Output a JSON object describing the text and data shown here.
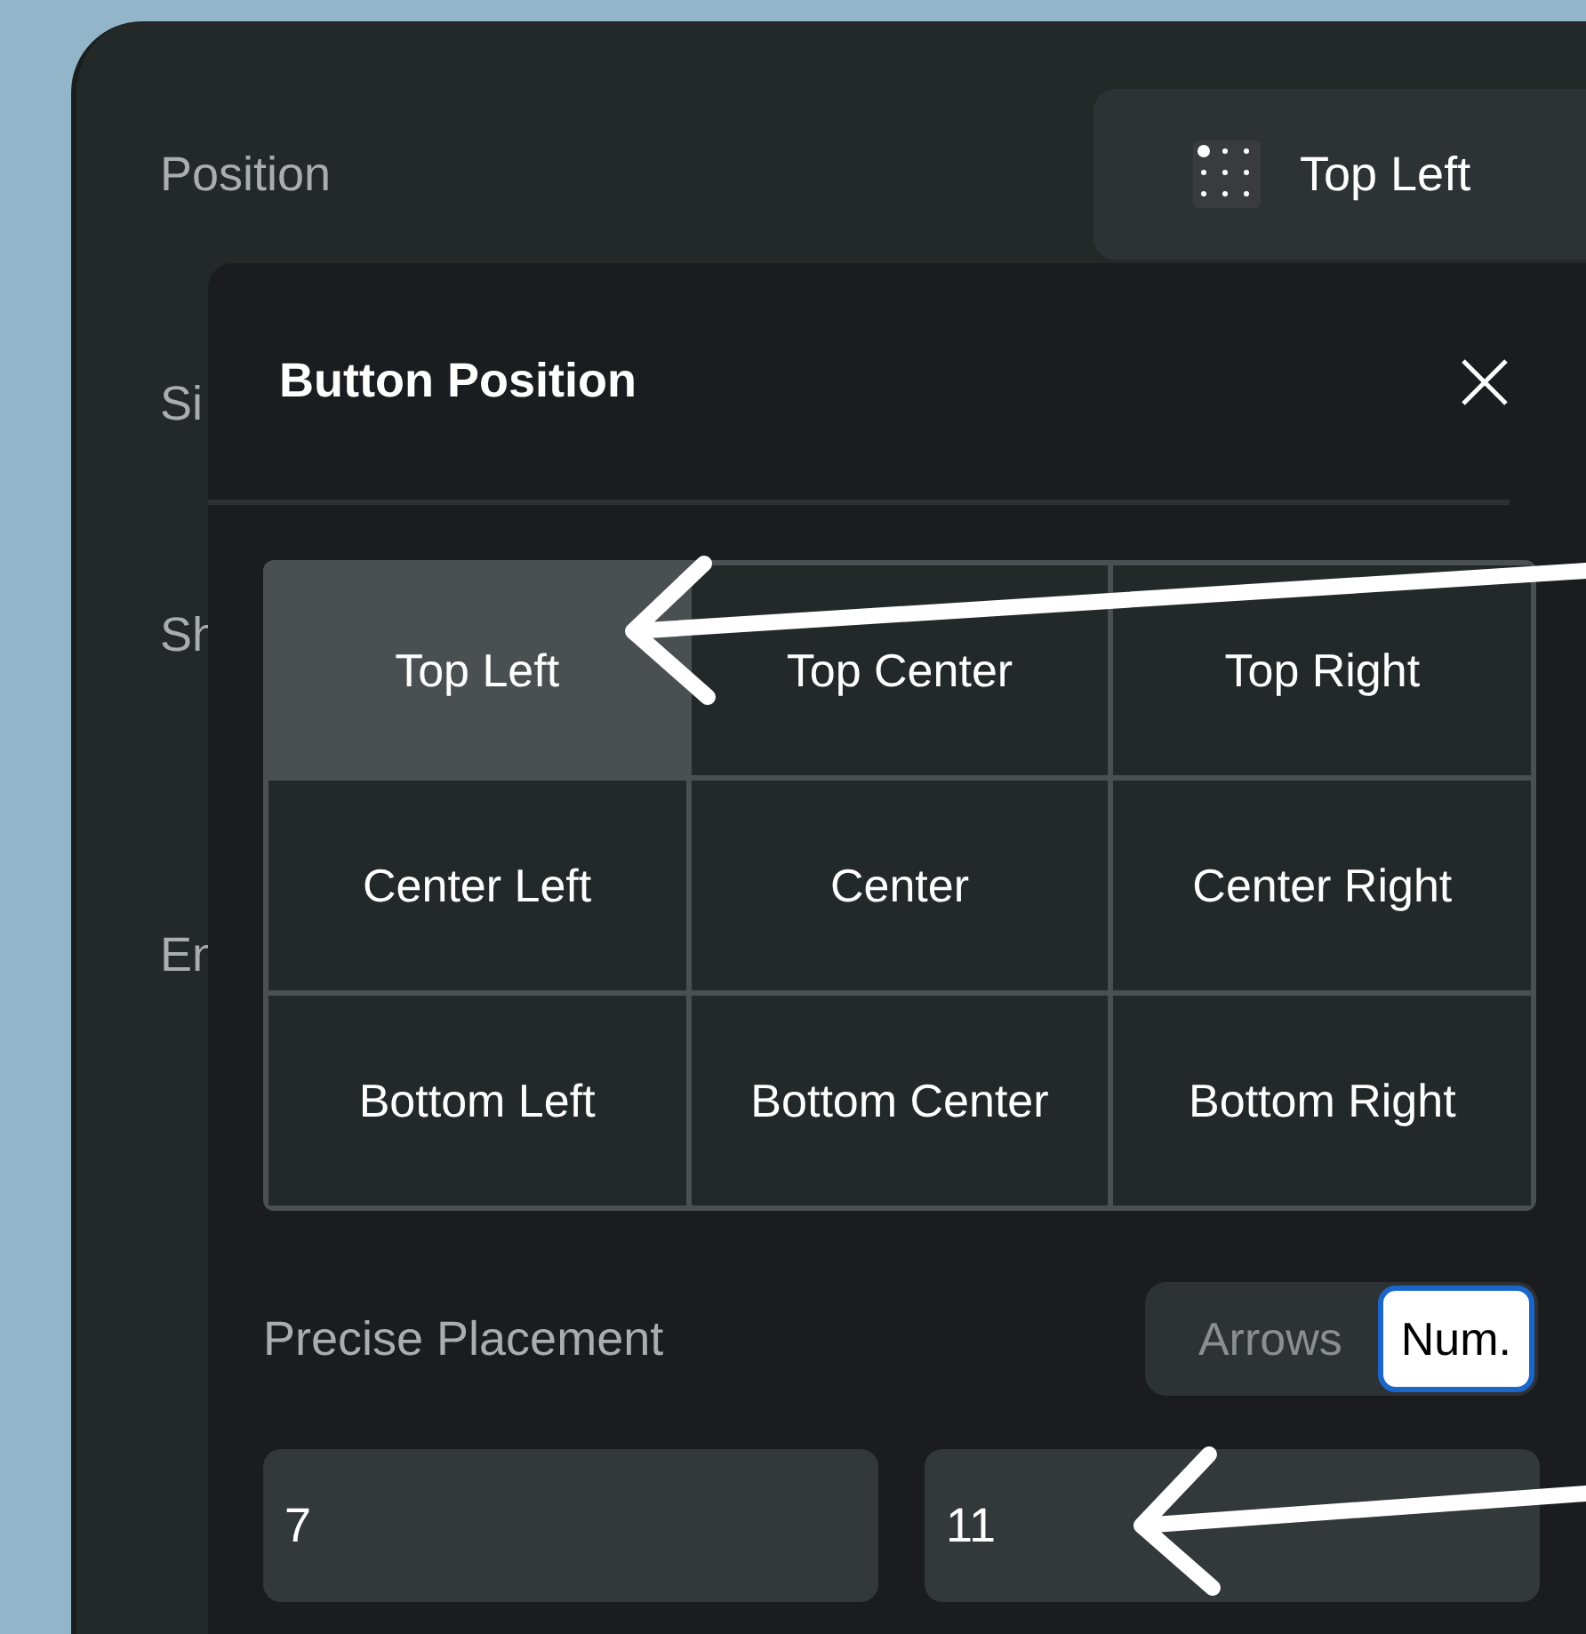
{
  "panel": {
    "labels": [
      {
        "text": "Position"
      },
      {
        "text": "Si"
      },
      {
        "text": "Sh"
      },
      {
        "text": "En"
      }
    ],
    "position_value": "Top Left"
  },
  "dialog": {
    "title": "Button Position",
    "grid": [
      {
        "label": "Top Left",
        "selected": true
      },
      {
        "label": "Top Center",
        "selected": false
      },
      {
        "label": "Top Right",
        "selected": false
      },
      {
        "label": "Center Left",
        "selected": false
      },
      {
        "label": "Center",
        "selected": false
      },
      {
        "label": "Center Right",
        "selected": false
      },
      {
        "label": "Bottom Left",
        "selected": false
      },
      {
        "label": "Bottom Center",
        "selected": false
      },
      {
        "label": "Bottom Right",
        "selected": false
      }
    ],
    "precise": {
      "label": "Precise Placement",
      "modes": [
        {
          "label": "Arrows",
          "selected": false
        },
        {
          "label": "Num.",
          "selected": true
        }
      ],
      "fields": [
        {
          "value": "7"
        },
        {
          "value": "11"
        }
      ]
    }
  }
}
